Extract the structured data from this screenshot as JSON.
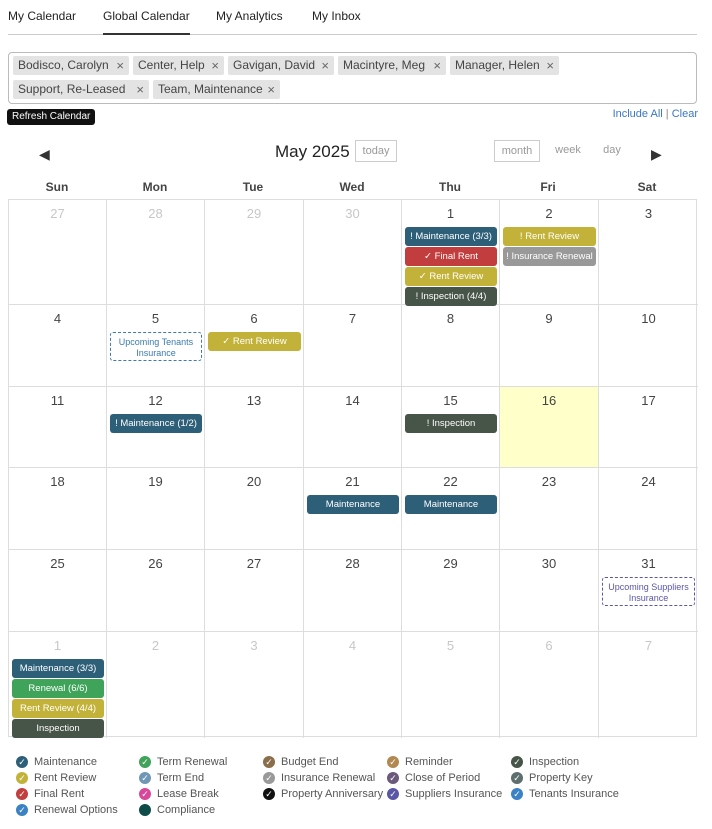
{
  "tabs": [
    "My Calendar",
    "Global Calendar",
    "My Analytics",
    "My Inbox"
  ],
  "filter_tags": [
    "Bodisco, Carolyn",
    "Center, Help",
    "Gavigan, David",
    "Macintyre, Meg",
    "Manager, Helen",
    "Support, Re-Leased",
    "Team, Maintenance"
  ],
  "tag_remove": "×",
  "refresh_label": "Refresh Calendar",
  "include_all": "Include All",
  "separator": "|",
  "clear": "Clear",
  "nav": {
    "prev": "◀",
    "next": "▶"
  },
  "calendar_title": "May 2025",
  "today_label": "today",
  "views": [
    "month",
    "week",
    "day"
  ],
  "weekdays": [
    "Sun",
    "Mon",
    "Tue",
    "Wed",
    "Thu",
    "Fri",
    "Sat"
  ],
  "weeks": [
    [
      {
        "d": "27",
        "other": true
      },
      {
        "d": "28",
        "other": true
      },
      {
        "d": "29",
        "other": true
      },
      {
        "d": "30",
        "other": true
      },
      {
        "d": "1"
      },
      {
        "d": "2"
      },
      {
        "d": "3"
      }
    ],
    [
      {
        "d": "4"
      },
      {
        "d": "5"
      },
      {
        "d": "6"
      },
      {
        "d": "7"
      },
      {
        "d": "8"
      },
      {
        "d": "9"
      },
      {
        "d": "10"
      }
    ],
    [
      {
        "d": "11"
      },
      {
        "d": "12"
      },
      {
        "d": "13"
      },
      {
        "d": "14"
      },
      {
        "d": "15"
      },
      {
        "d": "16",
        "today": true
      },
      {
        "d": "17"
      }
    ],
    [
      {
        "d": "18"
      },
      {
        "d": "19"
      },
      {
        "d": "20"
      },
      {
        "d": "21"
      },
      {
        "d": "22"
      },
      {
        "d": "23"
      },
      {
        "d": "24"
      }
    ],
    [
      {
        "d": "25"
      },
      {
        "d": "26"
      },
      {
        "d": "27"
      },
      {
        "d": "28"
      },
      {
        "d": "29"
      },
      {
        "d": "30"
      },
      {
        "d": "31"
      }
    ],
    [
      {
        "d": "1",
        "other": true
      },
      {
        "d": "2",
        "other": true
      },
      {
        "d": "3",
        "other": true
      },
      {
        "d": "4",
        "other": true
      },
      {
        "d": "5",
        "other": true
      },
      {
        "d": "6",
        "other": true
      },
      {
        "d": "7",
        "other": true
      }
    ]
  ],
  "events": [
    {
      "week": 0,
      "day": 4,
      "slot": 0,
      "label": "! Maintenance (3/3)",
      "color": "#2e5f78"
    },
    {
      "week": 0,
      "day": 4,
      "slot": 1,
      "label": "✓ Final Rent",
      "color": "#c23d3d"
    },
    {
      "week": 0,
      "day": 4,
      "slot": 2,
      "label": "✓ Rent Review",
      "color": "#c2b23a"
    },
    {
      "week": 0,
      "day": 4,
      "slot": 3,
      "label": "! Inspection (4/4)",
      "color": "#475448"
    },
    {
      "week": 0,
      "day": 5,
      "slot": 0,
      "label": "! Rent Review",
      "color": "#c2b23a"
    },
    {
      "week": 0,
      "day": 5,
      "slot": 1,
      "label": "! Insurance Renewal",
      "color": "#999999"
    },
    {
      "week": 1,
      "day": 1,
      "slot": 0,
      "label": "Upcoming Tenants Insurance",
      "dashed": true,
      "color": "#3b7bb0"
    },
    {
      "week": 1,
      "day": 2,
      "slot": 0,
      "label": "✓ Rent Review",
      "color": "#c2b23a"
    },
    {
      "week": 2,
      "day": 1,
      "slot": 0,
      "label": "! Maintenance (1/2)",
      "color": "#2e5f78"
    },
    {
      "week": 2,
      "day": 4,
      "slot": 0,
      "label": "! Inspection",
      "color": "#475448"
    },
    {
      "week": 3,
      "day": 3,
      "slot": 0,
      "label": "Maintenance",
      "color": "#2e5f78"
    },
    {
      "week": 3,
      "day": 4,
      "slot": 0,
      "label": "Maintenance",
      "color": "#2e5f78"
    },
    {
      "week": 4,
      "day": 6,
      "slot": 0,
      "label": "Upcoming Suppliers Insurance",
      "dashed": true,
      "color": "#5a57a5"
    },
    {
      "week": 5,
      "day": 0,
      "slot": 0,
      "label": "Maintenance (3/3)",
      "color": "#2e5f78"
    },
    {
      "week": 5,
      "day": 0,
      "slot": 1,
      "label": "Renewal (6/6)",
      "color": "#3fa35a"
    },
    {
      "week": 5,
      "day": 0,
      "slot": 2,
      "label": "Rent Review (4/4)",
      "color": "#c2b23a"
    },
    {
      "week": 5,
      "day": 0,
      "slot": 3,
      "label": "Inspection",
      "color": "#475448"
    }
  ],
  "legend": [
    [
      {
        "label": "Maintenance",
        "color": "#2e5f78",
        "mark": "✓"
      },
      {
        "label": "Rent Review",
        "color": "#c2b23a",
        "mark": "✓"
      },
      {
        "label": "Final Rent",
        "color": "#c23d3d",
        "mark": "✓"
      },
      {
        "label": "Renewal Options",
        "color": "#3b82c4",
        "mark": "✓"
      }
    ],
    [
      {
        "label": "Term Renewal",
        "color": "#3fa35a",
        "mark": "✓"
      },
      {
        "label": "Term End",
        "color": "#6f97b5",
        "mark": "✓"
      },
      {
        "label": "Lease Break",
        "color": "#d9479b",
        "mark": "✓"
      },
      {
        "label": "Compliance",
        "color": "#0f4c48",
        "mark": ""
      }
    ],
    [
      {
        "label": "Budget End",
        "color": "#8a6d4b",
        "mark": "✓"
      },
      {
        "label": "Insurance Renewal",
        "color": "#999999",
        "mark": "✓"
      },
      {
        "label": "Property Anniversary",
        "color": "#111111",
        "mark": "✓"
      }
    ],
    [
      {
        "label": "Reminder",
        "color": "#b08850",
        "mark": "✓"
      },
      {
        "label": "Close of Period",
        "color": "#6b5a7a",
        "mark": "✓"
      },
      {
        "label": "Suppliers Insurance",
        "color": "#5a57a5",
        "mark": "✓"
      }
    ],
    [
      {
        "label": "Inspection",
        "color": "#475448",
        "mark": "✓"
      },
      {
        "label": "Property Key",
        "color": "#5e6e6e",
        "mark": "✓"
      },
      {
        "label": "Tenants Insurance",
        "color": "#3b82c4",
        "mark": "✓"
      }
    ]
  ]
}
